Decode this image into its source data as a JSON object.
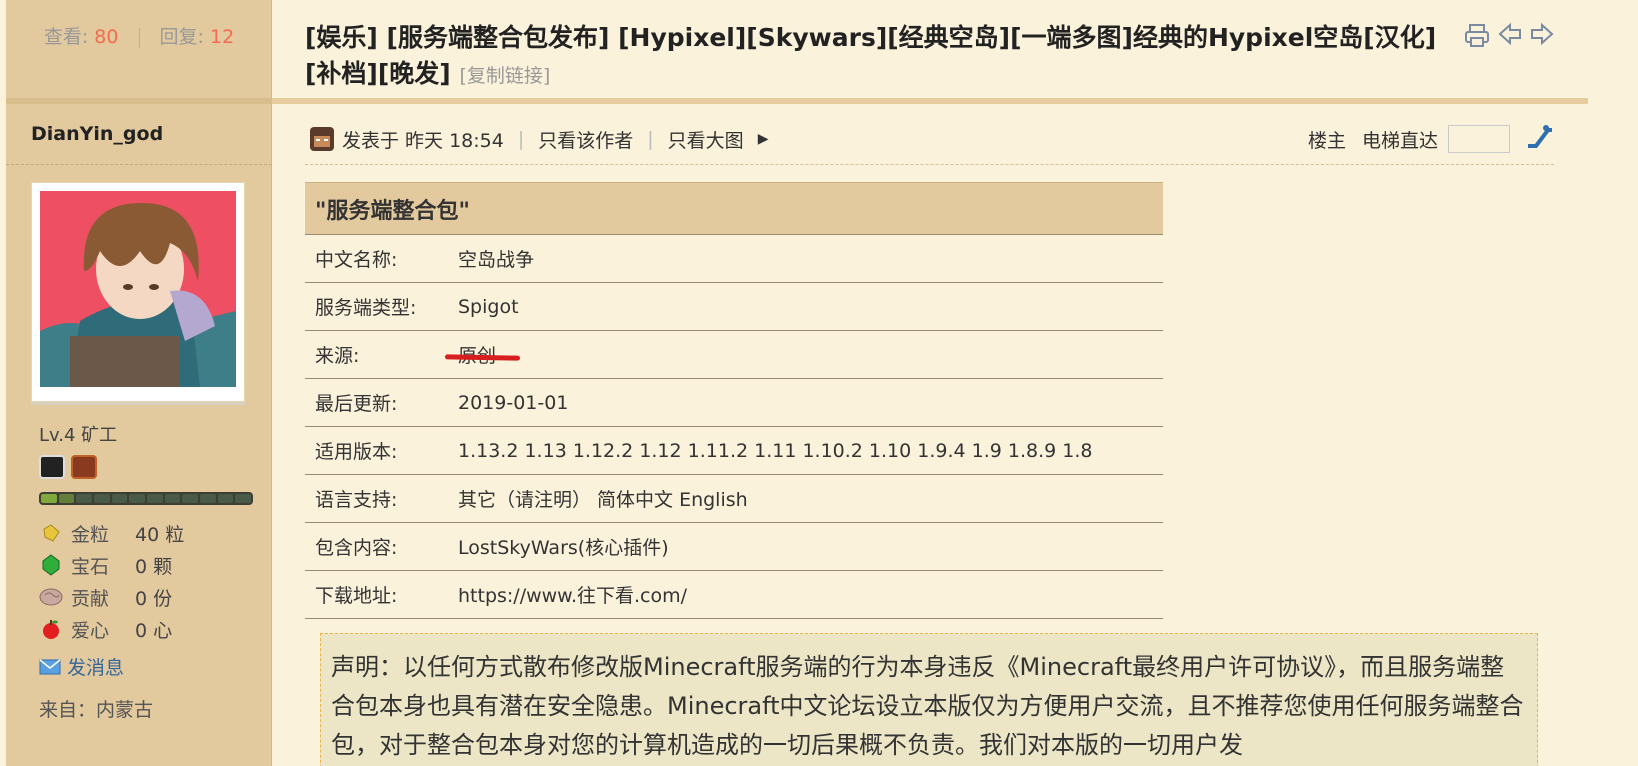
{
  "thread": {
    "views_label": "查看:",
    "views": "80",
    "replies_label": "回复:",
    "replies": "12",
    "title": "[娱乐] [服务端整合包发布] [Hypixel][Skywars][经典空岛][一端多图]经典的Hypixel空岛[汉化][补档][晚发]",
    "copy_link": "[复制链接]"
  },
  "author": {
    "name": "DianYin_god",
    "level": "Lv.4 矿工",
    "exp_fraction": 0.17,
    "attrs": [
      {
        "icon": "gold-nugget-icon",
        "key": "金粒",
        "value": "40 粒"
      },
      {
        "icon": "emerald-icon",
        "key": "宝石",
        "value": "0 颗"
      },
      {
        "icon": "brain-icon",
        "key": "贡献",
        "value": "0 份"
      },
      {
        "icon": "apple-icon",
        "key": "爱心",
        "value": "0 心"
      }
    ],
    "send_message": "发消息",
    "from": "来自：内蒙古"
  },
  "post_bar": {
    "posted": "发表于 昨天 18:54",
    "only_author": "只看该作者",
    "big_images": "只看大图",
    "floor": "楼主",
    "jump": "电梯直达"
  },
  "table": {
    "header": "\"服务端整合包\"",
    "rows": [
      {
        "key": "中文名称:",
        "value": "空岛战争"
      },
      {
        "key": "服务端类型:",
        "value": "Spigot"
      },
      {
        "key": "来源:",
        "value": "原创"
      },
      {
        "key": "最后更新:",
        "value": "2019-01-01"
      },
      {
        "key": "适用版本:",
        "value": "1.13.2 1.13 1.12.2 1.12 1.11.2 1.11 1.10.2 1.10 1.9.4 1.9 1.8.9 1.8"
      },
      {
        "key": "语言支持:",
        "value": "其它（请注明） 简体中文 English"
      },
      {
        "key": "包含内容:",
        "value": "LostSkyWars(核心插件)"
      },
      {
        "key": "下载地址:",
        "value": "https://www.往下看.com/"
      }
    ]
  },
  "notice": {
    "text": "声明：以任何方式散布修改版Minecraft服务端的行为本身违反《Minecraft最终用户许可协议》，而且服务端整合包本身也具有潜在安全隐患。Minecraft中文论坛设立本版仅为方便用户交流，且不推荐您使用任何服务端整合包，对于整合包本身对您的计算机造成的一切后果概不负责。我们对本版的一切用户发"
  },
  "colors": {
    "background": "#fbf2db",
    "sidebar": "#e3c99e",
    "accent_number": "#f26c4f",
    "link": "#336699",
    "highlight_line": "#d81e1e"
  }
}
